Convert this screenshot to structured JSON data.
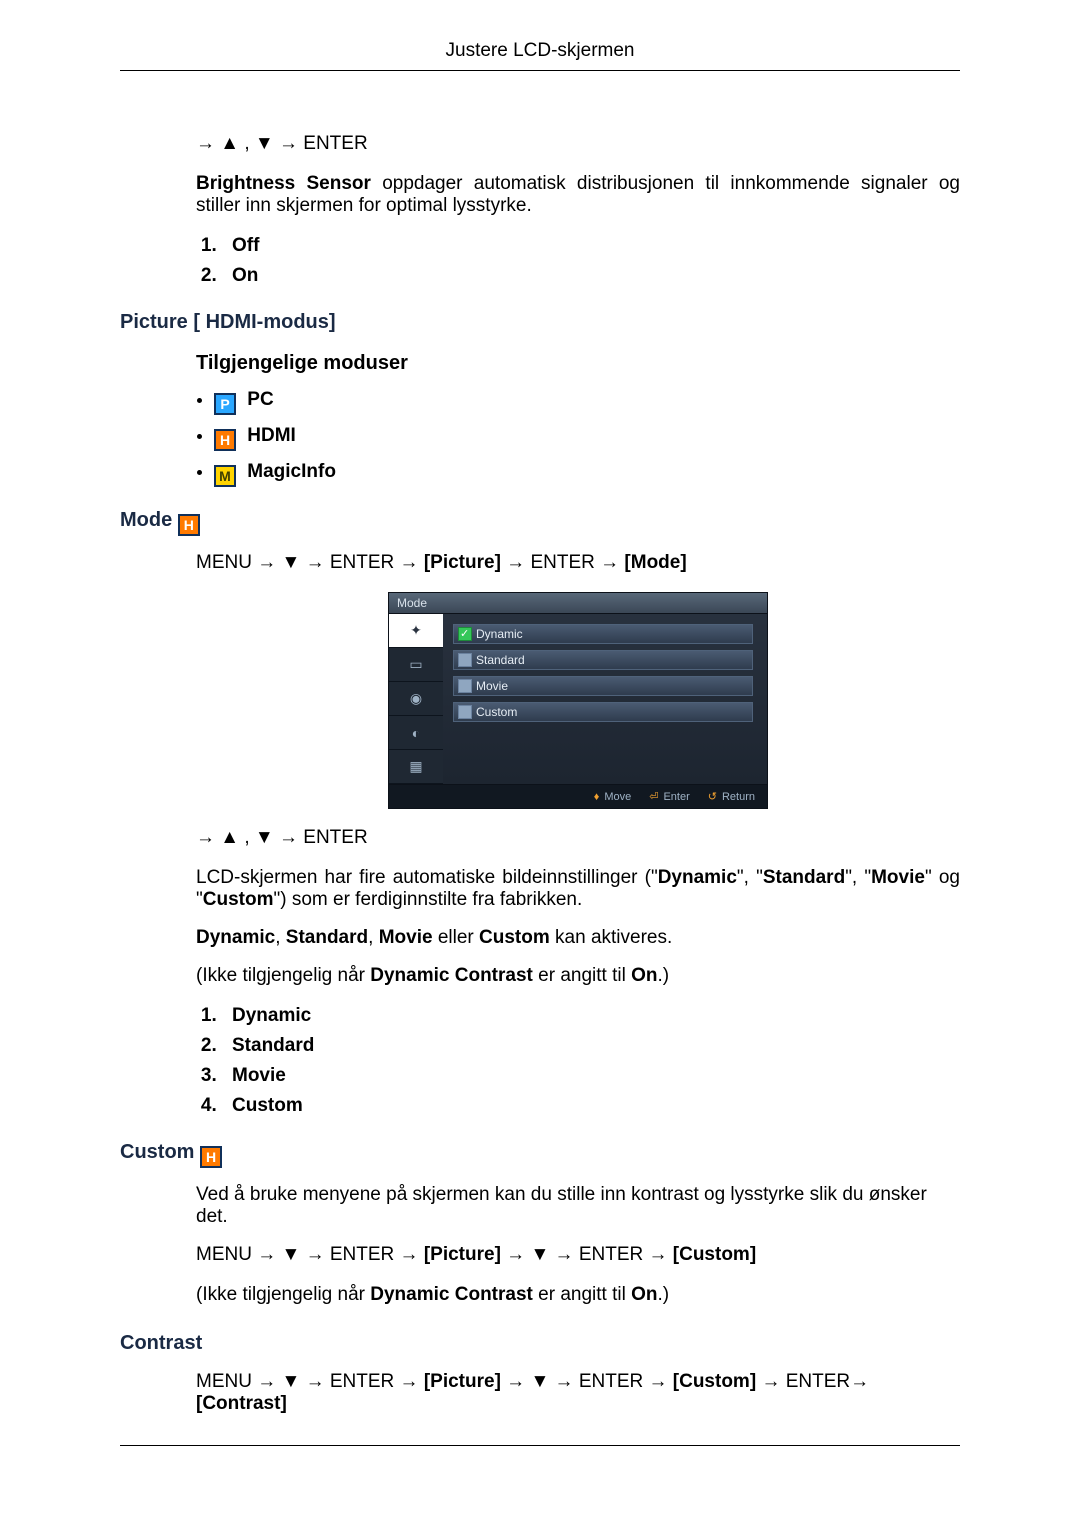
{
  "header": {
    "title": "Justere LCD-skjermen"
  },
  "brightness": {
    "nav": "→ ▲ , ▼ → ENTER",
    "desc_1a": "Brightness Sensor",
    "desc_1b": " oppdager automatisk distribusjonen til innkommende signaler og stiller inn skjermen for optimal lysstyrke.",
    "opts": [
      "Off",
      "On"
    ]
  },
  "picture_hdmi": {
    "heading": "Picture [ HDMI-modus]",
    "sub": "Tilgjengelige moduser",
    "modes": [
      {
        "letter": "P",
        "label": "PC"
      },
      {
        "letter": "H",
        "label": "HDMI"
      },
      {
        "letter": "M",
        "label": "MagicInfo"
      }
    ]
  },
  "mode": {
    "heading": "Mode",
    "h_icon": "H",
    "path_1": "MENU → ▼ → ENTER → ",
    "path_b1": "[Picture]",
    "path_2": " → ENTER → ",
    "path_b2": "[Mode]",
    "osd": {
      "title": "Mode",
      "items": [
        "Dynamic",
        "Standard",
        "Movie",
        "Custom"
      ],
      "footer": {
        "move": "Move",
        "enter": "Enter",
        "return": "Return"
      }
    },
    "nav2": "→ ▲ , ▼ → ENTER",
    "desc2_a": "LCD-skjermen har fire automatiske bildeinnstillinger (\"",
    "desc2_b": "Dynamic",
    "desc2_c": "\", \"",
    "desc2_d": "Standard",
    "desc2_e": "\", \"",
    "desc2_f": "Movie",
    "desc2_g": "\" og \"",
    "desc2_h": "Custom",
    "desc2_i": "\") som er ferdiginnstilte fra fabrikken.",
    "desc3_a": "Dynamic",
    "desc3_b": ", ",
    "desc3_c": "Standard",
    "desc3_d": ", ",
    "desc3_e": "Movie",
    "desc3_f": " eller ",
    "desc3_g": "Custom",
    "desc3_h": " kan aktiveres.",
    "desc4_a": "(Ikke tilgjengelig når ",
    "desc4_b": "Dynamic Contrast",
    "desc4_c": " er angitt til ",
    "desc4_d": "On",
    "desc4_e": ".)",
    "opts": [
      "Dynamic",
      "Standard",
      "Movie",
      "Custom"
    ]
  },
  "custom": {
    "heading": "Custom",
    "h_icon": "H",
    "desc": "Ved å bruke menyene på skjermen kan du stille inn kontrast og lysstyrke slik du ønsker det.",
    "path_1": "MENU → ▼ → ENTER → ",
    "path_b1": "[Picture]",
    "path_2": " → ▼ → ENTER → ",
    "path_b2": "[Custom]",
    "note_a": "(Ikke tilgjengelig når ",
    "note_b": "Dynamic Contrast",
    "note_c": " er angitt til ",
    "note_d": "On",
    "note_e": ".)"
  },
  "contrast": {
    "heading": "Contrast",
    "path_1": "MENU → ▼ → ENTER → ",
    "path_b1": "[Picture]",
    "path_2": " → ▼ → ENTER → ",
    "path_b2": "[Custom]",
    "path_3": " → ENTER→ ",
    "path_b3": "[Contrast]"
  }
}
